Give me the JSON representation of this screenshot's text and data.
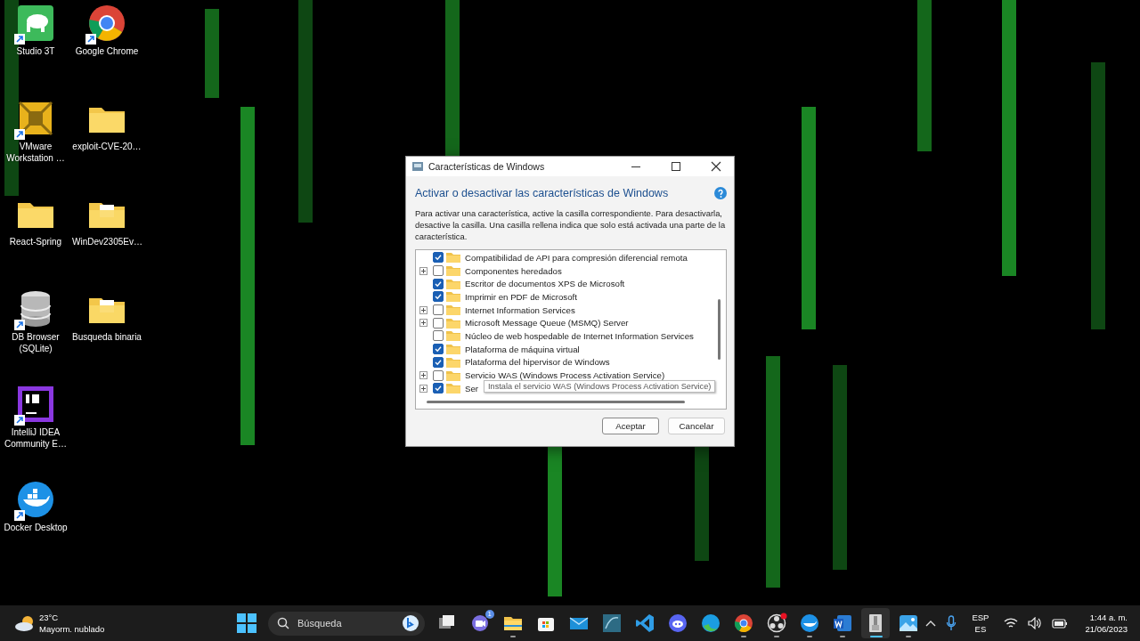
{
  "desktop": {
    "icons": [
      {
        "kind": "studio3t",
        "label": "Studio 3T",
        "shortcut": true
      },
      {
        "kind": "vmware",
        "label": "VMware Workstation …",
        "shortcut": true
      },
      {
        "kind": "folder",
        "label": "React-Spring",
        "shortcut": false
      },
      {
        "kind": "database",
        "label": "DB Browser (SQLite)",
        "shortcut": true
      },
      {
        "kind": "intellij",
        "label": "IntelliJ IDEA Community E…",
        "shortcut": true
      },
      {
        "kind": "docker",
        "label": "Docker Desktop",
        "shortcut": true
      },
      {
        "kind": "chrome",
        "label": "Google Chrome",
        "shortcut": true
      },
      {
        "kind": "folder",
        "label": "exploit-CVE-20…",
        "shortcut": false
      },
      {
        "kind": "folder-doc",
        "label": "WinDev2305Ev…",
        "shortcut": false
      },
      {
        "kind": "folder-doc",
        "label": "Busqueda binaria",
        "shortcut": false
      }
    ]
  },
  "window": {
    "title": "Características de Windows",
    "heading": "Activar o desactivar las características de Windows",
    "description": "Para activar una característica, active la casilla correspondiente. Para desactivarla, desactive la casilla. Una casilla rellena indica que solo está activada una parte de la característica.",
    "features": [
      {
        "label": "Compatibilidad de API para compresión diferencial remota",
        "checked": true,
        "expandable": false
      },
      {
        "label": "Componentes heredados",
        "checked": false,
        "expandable": true
      },
      {
        "label": "Escritor de documentos XPS de Microsoft",
        "checked": true,
        "expandable": false
      },
      {
        "label": "Imprimir en PDF de Microsoft",
        "checked": true,
        "expandable": false
      },
      {
        "label": "Internet Information Services",
        "checked": false,
        "expandable": true
      },
      {
        "label": "Microsoft Message Queue (MSMQ) Server",
        "checked": false,
        "expandable": true
      },
      {
        "label": "Núcleo de web hospedable de Internet Information Services",
        "checked": false,
        "expandable": false
      },
      {
        "label": "Plataforma de máquina virtual",
        "checked": true,
        "expandable": false
      },
      {
        "label": "Plataforma del hipervisor de Windows",
        "checked": true,
        "expandable": false
      },
      {
        "label": "Servicio WAS (Windows Process Activation Service)",
        "checked": false,
        "expandable": true
      },
      {
        "label": "Ser",
        "checked": true,
        "expandable": true
      }
    ],
    "tooltip": "Instala el servicio WAS (Windows Process Activation Service)",
    "buttons": [
      {
        "label": "Aceptar",
        "selected": true
      },
      {
        "label": "Cancelar",
        "selected": false
      }
    ]
  },
  "taskbar": {
    "weather": {
      "temperature": "23°C",
      "condition": "Mayorm. nublado"
    },
    "search": {
      "placeholder": "Búsqueda"
    },
    "apps": [
      {
        "kind": "taskview",
        "running": false,
        "selected": false
      },
      {
        "kind": "teams",
        "running": false,
        "selected": false,
        "badge": "1"
      },
      {
        "kind": "explorer",
        "running": true,
        "selected": false
      },
      {
        "kind": "store",
        "running": false,
        "selected": false
      },
      {
        "kind": "mail",
        "running": false,
        "selected": false
      },
      {
        "kind": "workbench",
        "running": false,
        "selected": false
      },
      {
        "kind": "vscode",
        "running": false,
        "selected": false
      },
      {
        "kind": "discord",
        "running": false,
        "selected": false
      },
      {
        "kind": "edge",
        "running": false,
        "selected": false
      },
      {
        "kind": "chrome",
        "running": true,
        "selected": false
      },
      {
        "kind": "obs",
        "running": true,
        "selected": false
      },
      {
        "kind": "docker",
        "running": true,
        "selected": false
      },
      {
        "kind": "word",
        "running": true,
        "selected": false
      },
      {
        "kind": "archive",
        "running": true,
        "selected": true
      },
      {
        "kind": "photos",
        "running": true,
        "selected": false
      }
    ],
    "language": {
      "top": "ESP",
      "bottom": "ES"
    },
    "time": "1:44 a. m.",
    "date": "21/06/2023"
  }
}
